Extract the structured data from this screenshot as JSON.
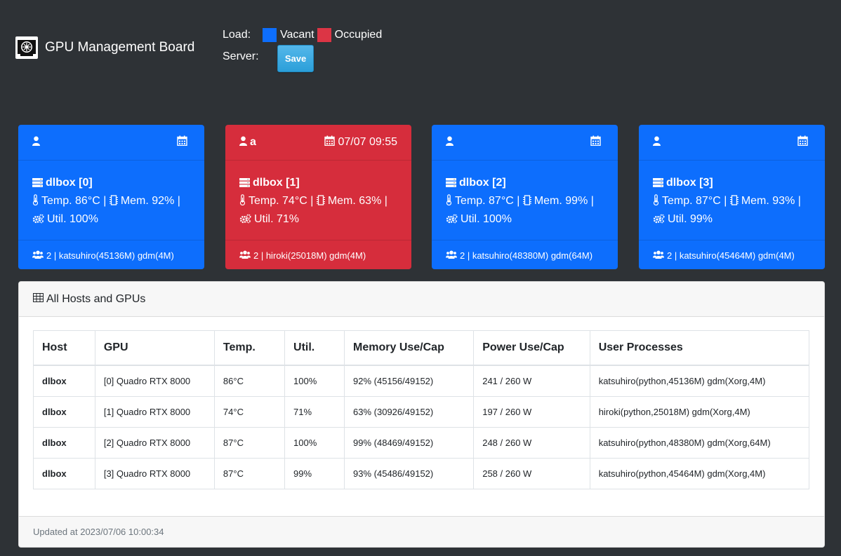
{
  "header": {
    "title": "GPU Management Board",
    "load_label": "Load:",
    "vacant_label": "Vacant",
    "occupied_label": "Occupied",
    "server_label": "Server:",
    "save_label": "Save",
    "colors": {
      "vacant": "#0d6efd",
      "occupied": "#d62d3c"
    }
  },
  "cards": [
    {
      "status": "vacant",
      "user": "",
      "datetime": "",
      "host": "dlbox [0]",
      "temp": "Temp. 86°C |",
      "mem": "Mem. 92% |",
      "util": "Util. 100%",
      "procs": "2 | katsuhiro(45136M) gdm(4M)"
    },
    {
      "status": "occupied",
      "user": "a",
      "datetime": "07/07 09:55",
      "host": "dlbox [1]",
      "temp": "Temp. 74°C |",
      "mem": "Mem. 63% |",
      "util": "Util. 71%",
      "procs": "2 | hiroki(25018M) gdm(4M)"
    },
    {
      "status": "vacant",
      "user": "",
      "datetime": "",
      "host": "dlbox [2]",
      "temp": "Temp. 87°C |",
      "mem": "Mem. 99% |",
      "util": "Util. 100%",
      "procs": "2 | katsuhiro(48380M) gdm(64M)"
    },
    {
      "status": "vacant",
      "user": "",
      "datetime": "",
      "host": "dlbox [3]",
      "temp": "Temp. 87°C |",
      "mem": "Mem. 93% |",
      "util": "Util. 99%",
      "procs": "2 | katsuhiro(45464M) gdm(4M)"
    }
  ],
  "panel": {
    "title": "All Hosts and GPUs",
    "columns": [
      "Host",
      "GPU",
      "Temp.",
      "Util.",
      "Memory Use/Cap",
      "Power Use/Cap",
      "User Processes"
    ],
    "rows": [
      [
        "dlbox",
        "[0] Quadro RTX 8000",
        "86°C",
        "100%",
        "92% (45156/49152)",
        "241 / 260 W",
        "katsuhiro(python,45136M) gdm(Xorg,4M)"
      ],
      [
        "dlbox",
        "[1] Quadro RTX 8000",
        "74°C",
        "71%",
        "63% (30926/49152)",
        "197 / 260 W",
        "hiroki(python,25018M) gdm(Xorg,4M)"
      ],
      [
        "dlbox",
        "[2] Quadro RTX 8000",
        "87°C",
        "100%",
        "99% (48469/49152)",
        "248 / 260 W",
        "katsuhiro(python,48380M) gdm(Xorg,64M)"
      ],
      [
        "dlbox",
        "[3] Quadro RTX 8000",
        "87°C",
        "99%",
        "93% (45486/49152)",
        "258 / 260 W",
        "katsuhiro(python,45464M) gdm(Xorg,4M)"
      ]
    ],
    "updated": "Updated at 2023/07/06 10:00:34"
  }
}
